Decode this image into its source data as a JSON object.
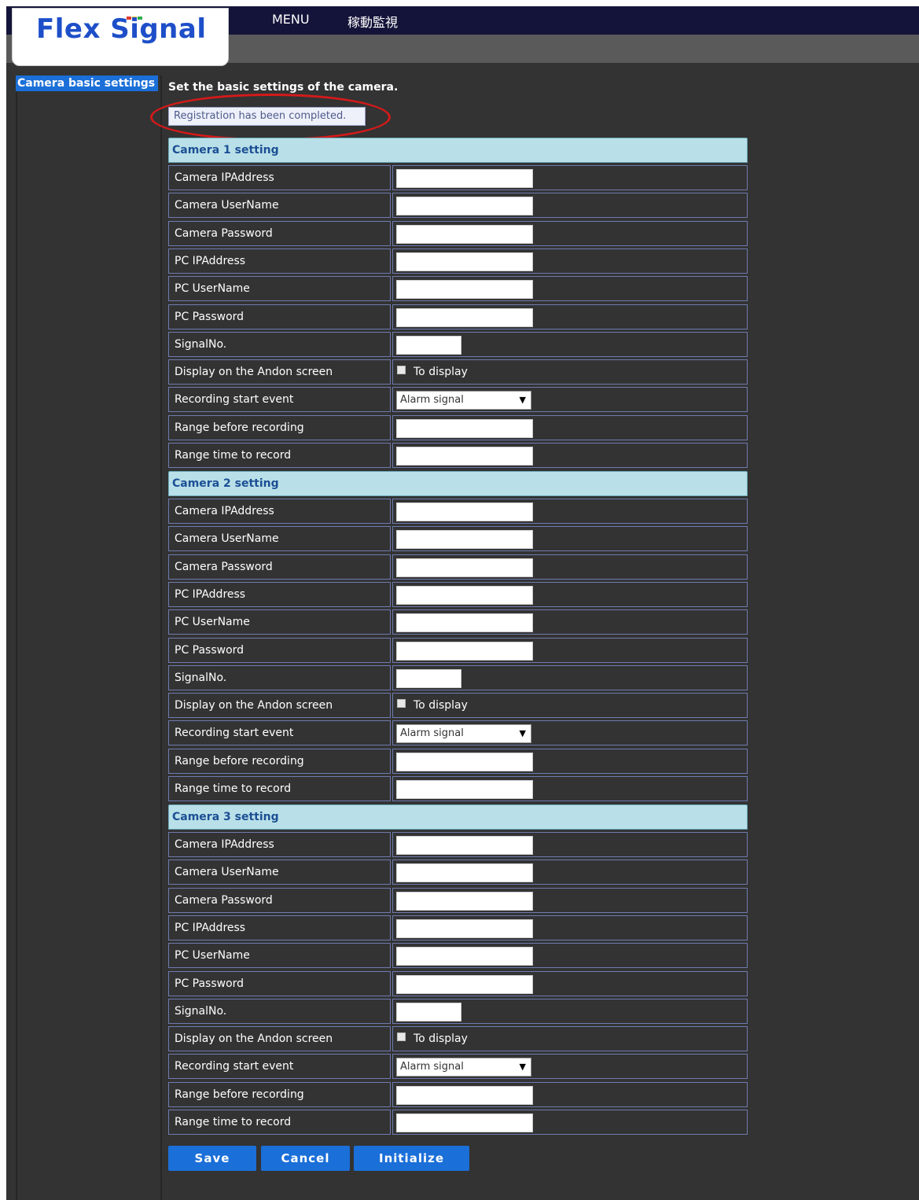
{
  "header": {
    "logo_text": "Flex Signal",
    "nav": [
      "MENU",
      "稼動監視"
    ]
  },
  "sidebar": {
    "items": [
      {
        "label": "Camera basic settings",
        "active": true
      }
    ]
  },
  "main": {
    "title": "Set the basic settings of the camera.",
    "notice": "Registration has been completed.",
    "sections": [
      {
        "title": "Camera 1 setting",
        "fields": [
          {
            "label": "Camera IPAddress",
            "type": "text",
            "value": ""
          },
          {
            "label": "Camera UserName",
            "type": "text",
            "value": ""
          },
          {
            "label": "Camera Password",
            "type": "text",
            "value": ""
          },
          {
            "label": "PC IPAddress",
            "type": "text",
            "value": ""
          },
          {
            "label": "PC UserName",
            "type": "text",
            "value": ""
          },
          {
            "label": "PC Password",
            "type": "text",
            "value": ""
          },
          {
            "label": "SignalNo.",
            "type": "short",
            "value": ""
          },
          {
            "label": "Display on the Andon screen",
            "type": "checkbox",
            "option": "To display",
            "checked": false
          },
          {
            "label": "Recording start event",
            "type": "select",
            "value": "Alarm signal"
          },
          {
            "label": "Range before recording",
            "type": "text",
            "value": ""
          },
          {
            "label": "Range time to record",
            "type": "text",
            "value": ""
          }
        ]
      },
      {
        "title": "Camera 2 setting",
        "fields": [
          {
            "label": "Camera IPAddress",
            "type": "text",
            "value": ""
          },
          {
            "label": "Camera UserName",
            "type": "text",
            "value": ""
          },
          {
            "label": "Camera Password",
            "type": "text",
            "value": ""
          },
          {
            "label": "PC IPAddress",
            "type": "text",
            "value": ""
          },
          {
            "label": "PC UserName",
            "type": "text",
            "value": ""
          },
          {
            "label": "PC Password",
            "type": "text",
            "value": ""
          },
          {
            "label": "SignalNo.",
            "type": "short",
            "value": ""
          },
          {
            "label": "Display on the Andon screen",
            "type": "checkbox",
            "option": "To display",
            "checked": false
          },
          {
            "label": "Recording start event",
            "type": "select",
            "value": "Alarm signal"
          },
          {
            "label": "Range before recording",
            "type": "text",
            "value": ""
          },
          {
            "label": "Range time to record",
            "type": "text",
            "value": ""
          }
        ]
      },
      {
        "title": "Camera 3 setting",
        "fields": [
          {
            "label": "Camera IPAddress",
            "type": "text",
            "value": ""
          },
          {
            "label": "Camera UserName",
            "type": "text",
            "value": ""
          },
          {
            "label": "Camera Password",
            "type": "text",
            "value": ""
          },
          {
            "label": "PC IPAddress",
            "type": "text",
            "value": ""
          },
          {
            "label": "PC UserName",
            "type": "text",
            "value": ""
          },
          {
            "label": "PC Password",
            "type": "text",
            "value": ""
          },
          {
            "label": "SignalNo.",
            "type": "short",
            "value": ""
          },
          {
            "label": "Display on the Andon screen",
            "type": "checkbox",
            "option": "To display",
            "checked": false
          },
          {
            "label": "Recording start event",
            "type": "select",
            "value": "Alarm signal"
          },
          {
            "label": "Range before recording",
            "type": "text",
            "value": ""
          },
          {
            "label": "Range time to record",
            "type": "text",
            "value": ""
          }
        ]
      }
    ],
    "buttons": [
      "Save",
      "Cancel",
      "Initialize"
    ]
  },
  "colors": {
    "accent": "#1b6fd8",
    "section_header": "#b9e0e8",
    "background": "#333333",
    "highlight_ring": "#d41a1a"
  }
}
